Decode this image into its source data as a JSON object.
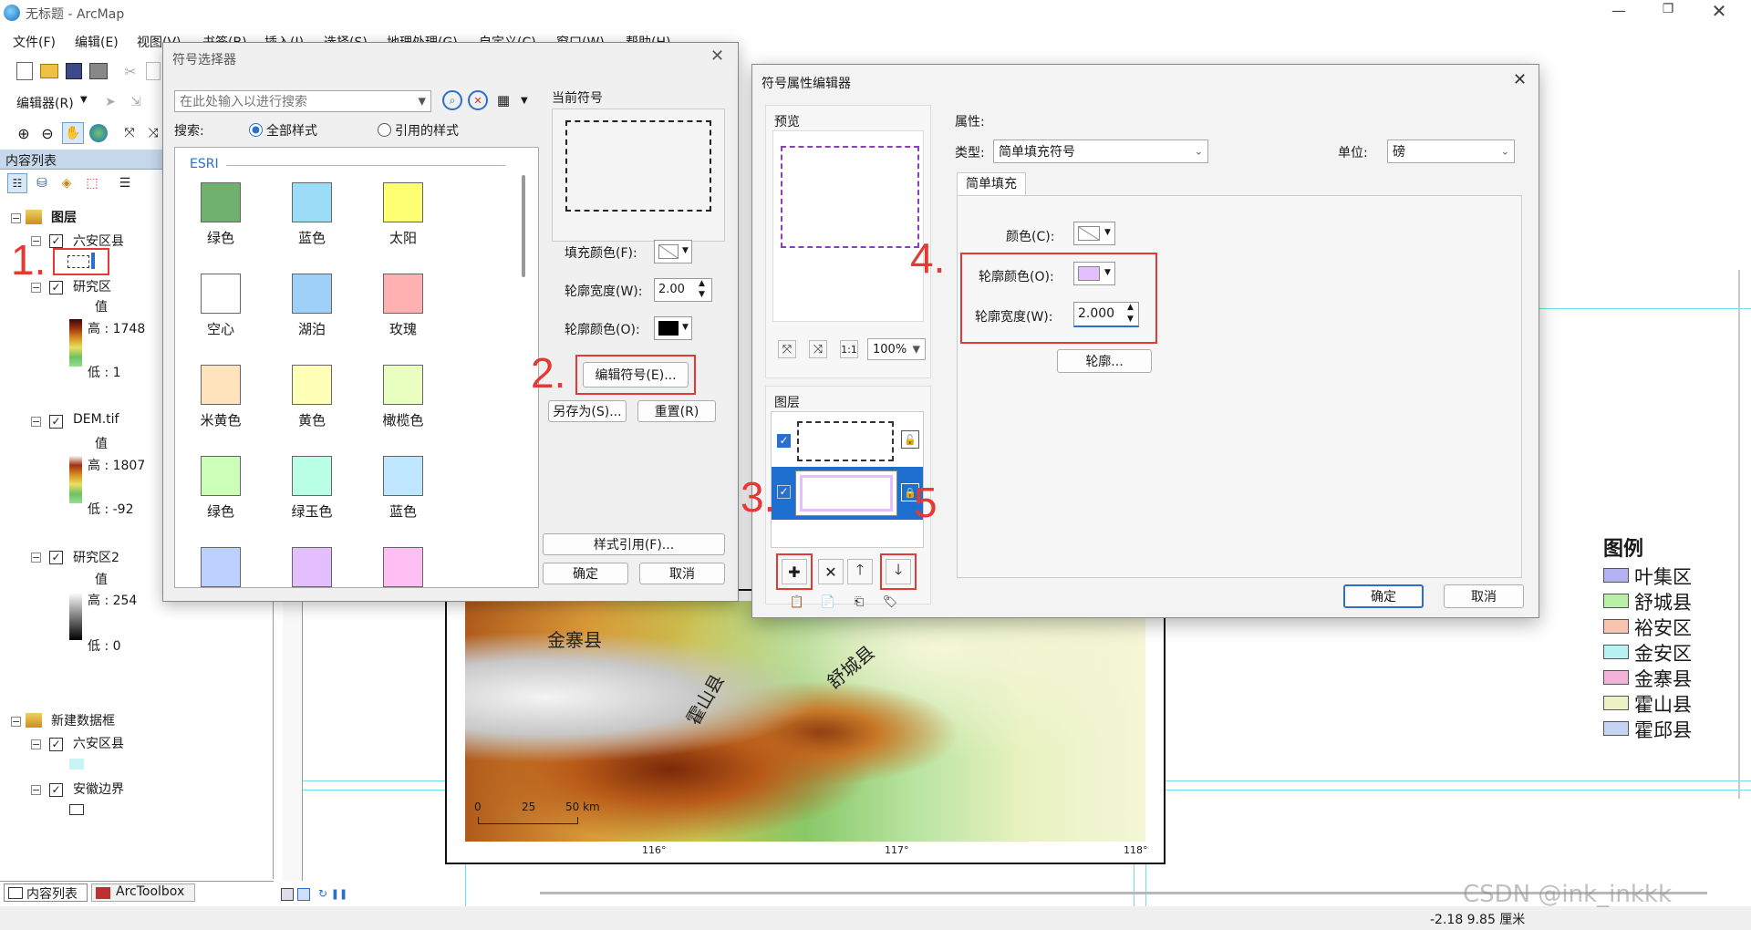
{
  "window": {
    "title": "无标题 - ArcMap"
  },
  "menu": [
    "文件(F)",
    "编辑(E)",
    "视图(V)",
    "书签(B)",
    "插入(I)",
    "选择(S)",
    "地理处理(G)",
    "自定义(C)",
    "窗口(W)",
    "帮助(H)"
  ],
  "editor_toolbar": {
    "label": "编辑器(R)"
  },
  "toc": {
    "title": "内容列表",
    "layers_group": "图层",
    "liuan": "六安区县",
    "study": "研究区",
    "value": "值",
    "study_high": "高 : 1748",
    "study_low": "低 : 1",
    "dem": "DEM.tif",
    "dem_high": "高 : 1807",
    "dem_low": "低 : -92",
    "study2": "研究区2",
    "study2_high": "高 : 254",
    "study2_low": "低 : 0",
    "new_frame": "新建数据框",
    "liuan2": "六安区县",
    "anhui": "安徽边界",
    "tabs": [
      "内容列表",
      "ArcToolbox"
    ]
  },
  "steps": [
    "1.",
    "2.",
    "3.",
    "4.",
    "5"
  ],
  "symbol_selector": {
    "title": "符号选择器",
    "search_placeholder": "在此处输入以进行搜索",
    "search_label": "搜索:",
    "all_styles": "全部样式",
    "ref_styles": "引用的样式",
    "group": "ESRI",
    "swatches": [
      {
        "label": "绿色",
        "color": "#70b170"
      },
      {
        "label": "蓝色",
        "color": "#9bdcf7"
      },
      {
        "label": "太阳",
        "color": "#ffff73"
      },
      {
        "label": "空心",
        "color": "#ffffff"
      },
      {
        "label": "湖泊",
        "color": "#9fd0f7"
      },
      {
        "label": "玫瑰",
        "color": "#ffb0b0"
      },
      {
        "label": "米黄色",
        "color": "#ffe3bd"
      },
      {
        "label": "黄色",
        "color": "#ffffb8"
      },
      {
        "label": "橄榄色",
        "color": "#e8ffbf"
      },
      {
        "label": "绿色",
        "color": "#ccffb8"
      },
      {
        "label": "绿玉色",
        "color": "#b8ffe5"
      },
      {
        "label": "蓝色",
        "color": "#bfe6ff"
      },
      {
        "label": "",
        "color": "#bcd1ff"
      },
      {
        "label": "",
        "color": "#e3bfff"
      },
      {
        "label": "",
        "color": "#ffbff2"
      }
    ],
    "current_symbol": "当前符号",
    "fill_color": "填充颜色(F):",
    "outline_width": "轮廓宽度(W):",
    "outline_width_value": "2.00",
    "outline_color": "轮廓颜色(O):",
    "edit_symbol": "编辑符号(E)...",
    "save_as": "另存为(S)...",
    "reset": "重置(R)",
    "style_ref": "样式引用(F)...",
    "ok": "确定",
    "cancel": "取消"
  },
  "property_editor": {
    "title": "符号属性编辑器",
    "preview": "预览",
    "zoom": "100%",
    "layers": "图层",
    "properties": "属性:",
    "type_label": "类型:",
    "type_value": "简单填充符号",
    "unit_label": "单位:",
    "unit_value": "磅",
    "tab": "简单填充",
    "color_label": "颜色(C):",
    "outline_color_label": "轮廓颜色(O):",
    "outline_width_label": "轮廓宽度(W):",
    "outline_width_value": "2.000",
    "outline_btn": "轮廓...",
    "ok": "确定",
    "cancel": "取消",
    "colors": {
      "outline_color": "#e3bfff",
      "preview_border": "#8a3fbf"
    }
  },
  "map": {
    "labels": [
      "金寨县",
      "霍山县",
      "舒城县"
    ],
    "scale": [
      "0",
      "25",
      "50 km"
    ],
    "lon_ticks": [
      "116°",
      "117°",
      "118°"
    ]
  },
  "legend": {
    "title": "图例",
    "items": [
      {
        "label": "叶集区",
        "color": "#b3b3f2"
      },
      {
        "label": "舒城县",
        "color": "#b8f0a8"
      },
      {
        "label": "裕安区",
        "color": "#f7c4b0"
      },
      {
        "label": "金安区",
        "color": "#b8f2f2"
      },
      {
        "label": "金寨县",
        "color": "#f2b3d9"
      },
      {
        "label": "霍山县",
        "color": "#eef2c4"
      },
      {
        "label": "霍邱县",
        "color": "#c4d4f2"
      }
    ]
  },
  "statusbar": {
    "coords": "-2.18  9.85 厘米"
  },
  "watermark": "CSDN @ink_inkkk"
}
